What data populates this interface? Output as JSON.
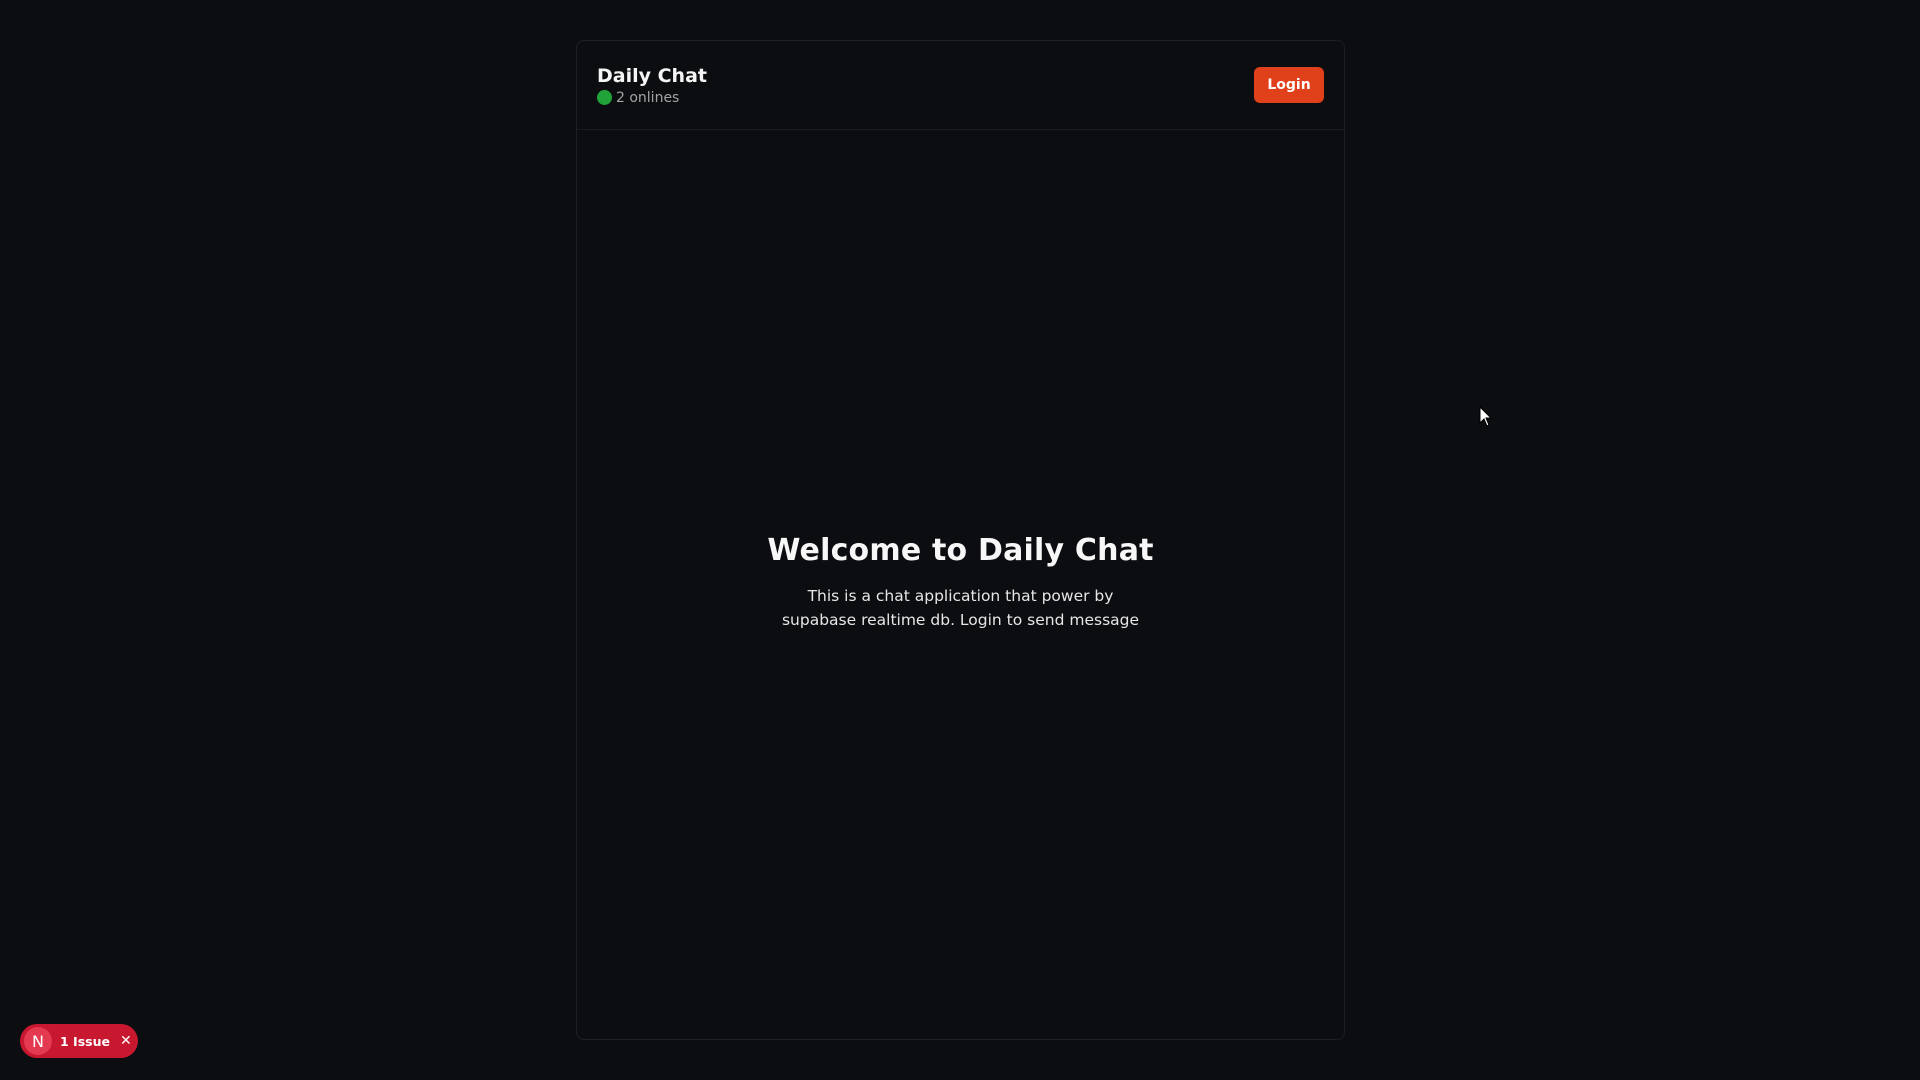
{
  "header": {
    "title": "Daily Chat",
    "online_count": "2 onlines",
    "login_label": "Login"
  },
  "welcome": {
    "title": "Welcome to Daily Chat",
    "description": "This is a chat application that power by supabase realtime db. Login to send message"
  },
  "issue_badge": {
    "letter": "N",
    "label": "1 Issue",
    "close": "✕"
  },
  "colors": {
    "background": "#0c0d10",
    "accent": "#e0401a",
    "online": "#22a33a",
    "issue": "#c8182f"
  }
}
